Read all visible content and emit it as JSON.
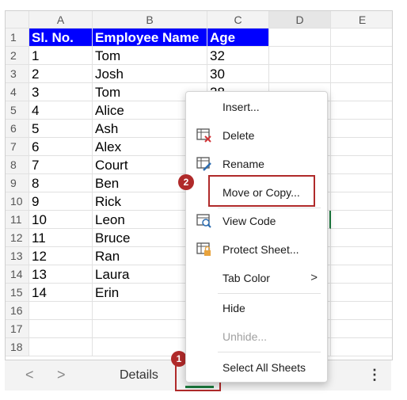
{
  "columns": [
    "A",
    "B",
    "C",
    "D",
    "E"
  ],
  "rows": [
    {
      "n": "1",
      "a": "Sl. No.",
      "b": "Employee Name",
      "c": "Age",
      "header": true
    },
    {
      "n": "2",
      "a": "1",
      "b": "Tom",
      "c": "32"
    },
    {
      "n": "3",
      "a": "2",
      "b": "Josh",
      "c": "30"
    },
    {
      "n": "4",
      "a": "3",
      "b": "Tom",
      "c": "28"
    },
    {
      "n": "5",
      "a": "4",
      "b": "Alice",
      "c": ""
    },
    {
      "n": "6",
      "a": "5",
      "b": "Ash",
      "c": ""
    },
    {
      "n": "7",
      "a": "6",
      "b": "Alex",
      "c": ""
    },
    {
      "n": "8",
      "a": "7",
      "b": "Court",
      "c": ""
    },
    {
      "n": "9",
      "a": "8",
      "b": "Ben",
      "c": ""
    },
    {
      "n": "10",
      "a": "9",
      "b": "Rick",
      "c": ""
    },
    {
      "n": "11",
      "a": "10",
      "b": "Leon",
      "c": ""
    },
    {
      "n": "12",
      "a": "11",
      "b": "Bruce",
      "c": ""
    },
    {
      "n": "13",
      "a": "12",
      "b": "Ran",
      "c": ""
    },
    {
      "n": "14",
      "a": "13",
      "b": "Laura",
      "c": ""
    },
    {
      "n": "15",
      "a": "14",
      "b": "Erin",
      "c": ""
    },
    {
      "n": "16",
      "a": "",
      "b": "",
      "c": ""
    },
    {
      "n": "17",
      "a": "",
      "b": "",
      "c": ""
    },
    {
      "n": "18",
      "a": "",
      "b": "",
      "c": ""
    }
  ],
  "tabs": {
    "prev": "<",
    "next": ">",
    "details": "Details",
    "more": "⋮"
  },
  "menu": {
    "insert": "Insert...",
    "delete": "Delete",
    "rename": "Rename",
    "move_copy": "Move or Copy...",
    "view_code": "View Code",
    "protect_sheet": "Protect Sheet...",
    "tab_color": "Tab Color",
    "hide": "Hide",
    "unhide": "Unhide...",
    "select_all": "Select All Sheets",
    "submenu_arrow": ">"
  },
  "badges": {
    "one": "1",
    "two": "2"
  },
  "colors": {
    "highlight": "#b02a2a",
    "header_fill": "#0000ff",
    "tab_active": "#1b7a3e"
  }
}
